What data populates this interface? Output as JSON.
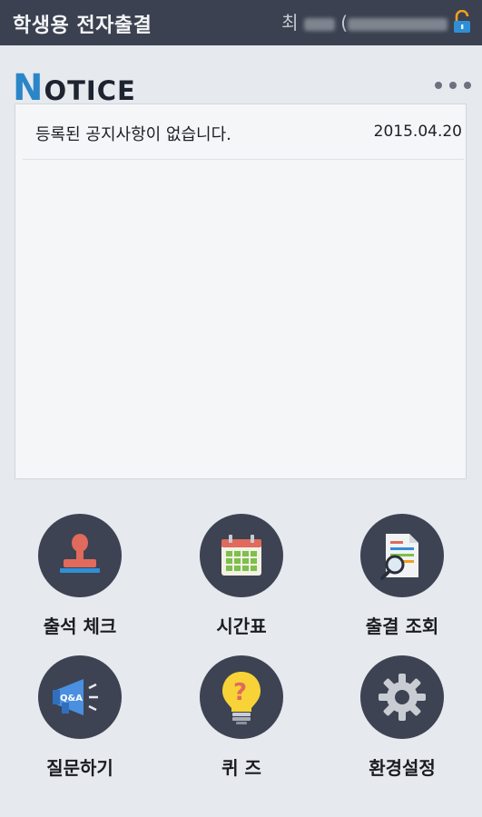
{
  "header": {
    "title": "학생용 전자출결",
    "user_name_prefix": "최"
  },
  "notice": {
    "title_first_letter": "N",
    "title_rest": "OTICE",
    "items": [
      {
        "text": "등록된 공지사항이 없습니다.",
        "date": "2015.04.20"
      }
    ]
  },
  "menu": [
    {
      "label": "출석 체크",
      "icon": "stamp-icon"
    },
    {
      "label": "시간표",
      "icon": "calendar-icon"
    },
    {
      "label": "출결 조회",
      "icon": "document-search-icon"
    },
    {
      "label": "질문하기",
      "icon": "megaphone-qa-icon"
    },
    {
      "label": "퀴 즈",
      "icon": "lightbulb-question-icon"
    },
    {
      "label": "환경설정",
      "icon": "gear-icon"
    }
  ],
  "colors": {
    "topbar": "#3b4150",
    "accent": "#2a86c8",
    "circle": "#3d4352",
    "background": "#e6e9ee"
  }
}
